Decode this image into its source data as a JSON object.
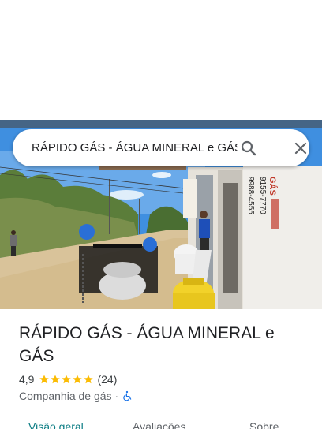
{
  "search": {
    "query": "RÁPIDO GÁS - ÁGUA MINERAL e GÁS"
  },
  "place": {
    "title": "RÁPIDO GÁS - ÁGUA MINERAL e GÁS",
    "rating": "4,9",
    "stars": 5,
    "review_count": "(24)",
    "category": "Companhia de gás",
    "separator": "·",
    "accessibility_icon": "wheelchair-icon",
    "star_color": "#fbbc04"
  },
  "tabs": [
    {
      "label": "Visão geral",
      "active": true
    },
    {
      "label": "Avaliações",
      "active": false
    },
    {
      "label": "Sobre",
      "active": false
    }
  ],
  "colors": {
    "accent": "#0b7c83",
    "accessibility": "#1a73e8"
  },
  "photo": {
    "wall_text": "GÁS"
  }
}
